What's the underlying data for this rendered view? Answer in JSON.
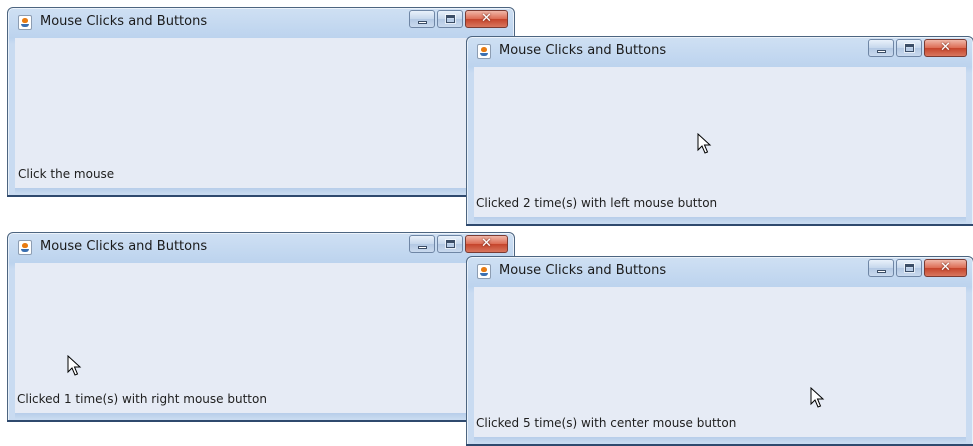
{
  "windows": [
    {
      "id": "w1",
      "title": "Mouse Clicks and Buttons",
      "status_text": "Click the mouse",
      "cursor_visible": false,
      "controls": {
        "minimize": "minimize",
        "maximize": "maximize",
        "close": "close"
      }
    },
    {
      "id": "w2",
      "title": "Mouse Clicks and Buttons",
      "status_text": "Clicked 2 time(s) with left mouse button",
      "cursor_visible": true,
      "controls": {
        "minimize": "minimize",
        "maximize": "maximize",
        "close": "close"
      }
    },
    {
      "id": "w3",
      "title": "Mouse Clicks and Buttons",
      "status_text": "Clicked 1 time(s) with right mouse button",
      "cursor_visible": true,
      "controls": {
        "minimize": "minimize",
        "maximize": "maximize",
        "close": "close"
      }
    },
    {
      "id": "w4",
      "title": "Mouse Clicks and Buttons",
      "status_text": "Clicked 5 time(s) with center mouse button",
      "cursor_visible": true,
      "controls": {
        "minimize": "minimize",
        "maximize": "maximize",
        "close": "close"
      }
    }
  ],
  "icons": {
    "app": "java-app-icon",
    "minimize": "minimize-icon",
    "maximize": "maximize-icon",
    "close": "close-icon",
    "cursor": "mouse-pointer-icon"
  },
  "colors": {
    "client_bg": "#e6ebf5",
    "titlebar": "#bcd3ee",
    "close_button": "#c5442b"
  }
}
